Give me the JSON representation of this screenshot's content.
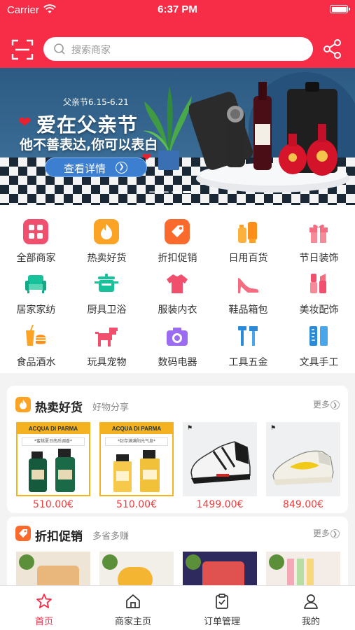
{
  "status_bar": {
    "carrier": "Carrier",
    "time": "6:37 PM"
  },
  "header": {
    "search_placeholder": "搜索商家",
    "scan_icon": "scan-icon",
    "share_icon": "share-icon",
    "brand_color": "#f72c47"
  },
  "banner": {
    "subtitle": "父亲节6.15-6.21",
    "title": "爱在父亲节",
    "slogan": "他不善表达,你可以表白",
    "button_label": "查看详情",
    "active_dot": 4,
    "dot_count": 4
  },
  "categories": [
    {
      "label": "全部商家",
      "icon": "grid-icon",
      "color": "#f0506e"
    },
    {
      "label": "热卖好货",
      "icon": "fire-icon",
      "color": "#fba325"
    },
    {
      "label": "折扣促销",
      "icon": "tag-icon",
      "color": "#fa6a2c"
    },
    {
      "label": "日用百货",
      "icon": "daily-goods-icon",
      "color": "#fba325"
    },
    {
      "label": "节日装饰",
      "icon": "gift-icon",
      "color": "#f36c7f"
    },
    {
      "label": "居家家纺",
      "icon": "sofa-icon",
      "color": "#17c29b"
    },
    {
      "label": "厨具卫浴",
      "icon": "pot-icon",
      "color": "#17c29b"
    },
    {
      "label": "服装内衣",
      "icon": "shirt-icon",
      "color": "#f0506e"
    },
    {
      "label": "鞋品箱包",
      "icon": "high-heel-icon",
      "color": "#f36c7f"
    },
    {
      "label": "美妆配饰",
      "icon": "makeup-icon",
      "color": "#f0506e"
    },
    {
      "label": "食品酒水",
      "icon": "food-drink-icon",
      "color": "#fba325"
    },
    {
      "label": "玩具宠物",
      "icon": "dog-toy-icon",
      "color": "#f0506e"
    },
    {
      "label": "数码电器",
      "icon": "camera-icon",
      "color": "#9b6cf2"
    },
    {
      "label": "工具五金",
      "icon": "tools-icon",
      "color": "#2b8ad8"
    },
    {
      "label": "文具手工",
      "icon": "ruler-icon",
      "color": "#2b8ad8"
    }
  ],
  "hot_section": {
    "title": "热卖好货",
    "subtitle": "好物分享",
    "more": "更多",
    "icon_color": "#fba325",
    "products": [
      {
        "brand": "ACQUA DI PARMA",
        "tag": "*蜜桃夏日南后调香*",
        "price": "510.00€"
      },
      {
        "brand": "ACQUA DI PARMA",
        "tag": "*封存满满阳光气息*",
        "price": "510.00€"
      },
      {
        "brand_logo": "jumpman-logo",
        "price": "1499.00€"
      },
      {
        "brand_logo": "jumpman-logo",
        "price": "849.00€"
      }
    ]
  },
  "discount_section": {
    "title": "折扣促销",
    "subtitle": "多省多赚",
    "more": "更多",
    "icon_color": "#fa6a2c"
  },
  "tabbar": {
    "tabs": [
      {
        "label": "首页",
        "icon": "star-icon",
        "active": true
      },
      {
        "label": "商家主页",
        "icon": "home-icon",
        "active": false
      },
      {
        "label": "订单管理",
        "icon": "clipboard-icon",
        "active": false
      },
      {
        "label": "我的",
        "icon": "user-icon",
        "active": false
      }
    ],
    "active_color": "#f72c47"
  }
}
